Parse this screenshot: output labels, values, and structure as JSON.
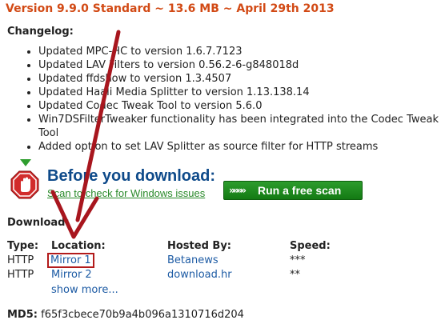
{
  "header": {
    "version_title": "Version 9.9.0 Standard ~ 13.6 MB ~ April 29th 2013"
  },
  "changelog": {
    "label": "Changelog:",
    "items": [
      "Updated MPC-HC to version 1.6.7.7123",
      "Updated LAV Filters to version 0.56.2-6-g848018d",
      "Updated ffdshow to version 1.3.4507",
      "Updated Haali Media Splitter to version 1.13.138.14",
      "Updated Codec Tweak Tool to version 5.6.0",
      "Win7DSFilterTweaker functionality has been integrated into the Codec Tweak Tool",
      "Added option to set LAV Splitter as source filter for HTTP streams"
    ]
  },
  "ad": {
    "headline": "Before you download:",
    "subtext": "Scan to check for Windows issues",
    "button_label": "Run a free scan",
    "button_chevrons": "»»»»",
    "colors": {
      "headline": "#0e4a8a",
      "subtext": "#2a8a2a",
      "button": "#1f8a1f",
      "stop_sign": "#d22b2b"
    }
  },
  "download": {
    "label": "Download:",
    "columns": [
      "Type:",
      "Location:",
      "Hosted By:",
      "Speed:"
    ],
    "rows": [
      {
        "type": "HTTP",
        "location": "Mirror 1",
        "hosted_by": "Betanews",
        "speed": "***"
      },
      {
        "type": "HTTP",
        "location": "Mirror 2",
        "hosted_by": "download.hr",
        "speed": "**"
      }
    ],
    "show_more": "show more..."
  },
  "md5": {
    "label": "MD5:",
    "value": "f65f3cbece70b9a4b096a1310716d204"
  },
  "colors": {
    "title_orange": "#d24a15",
    "link_blue": "#1d5ba4",
    "annotation_red": "#b31b1b"
  }
}
